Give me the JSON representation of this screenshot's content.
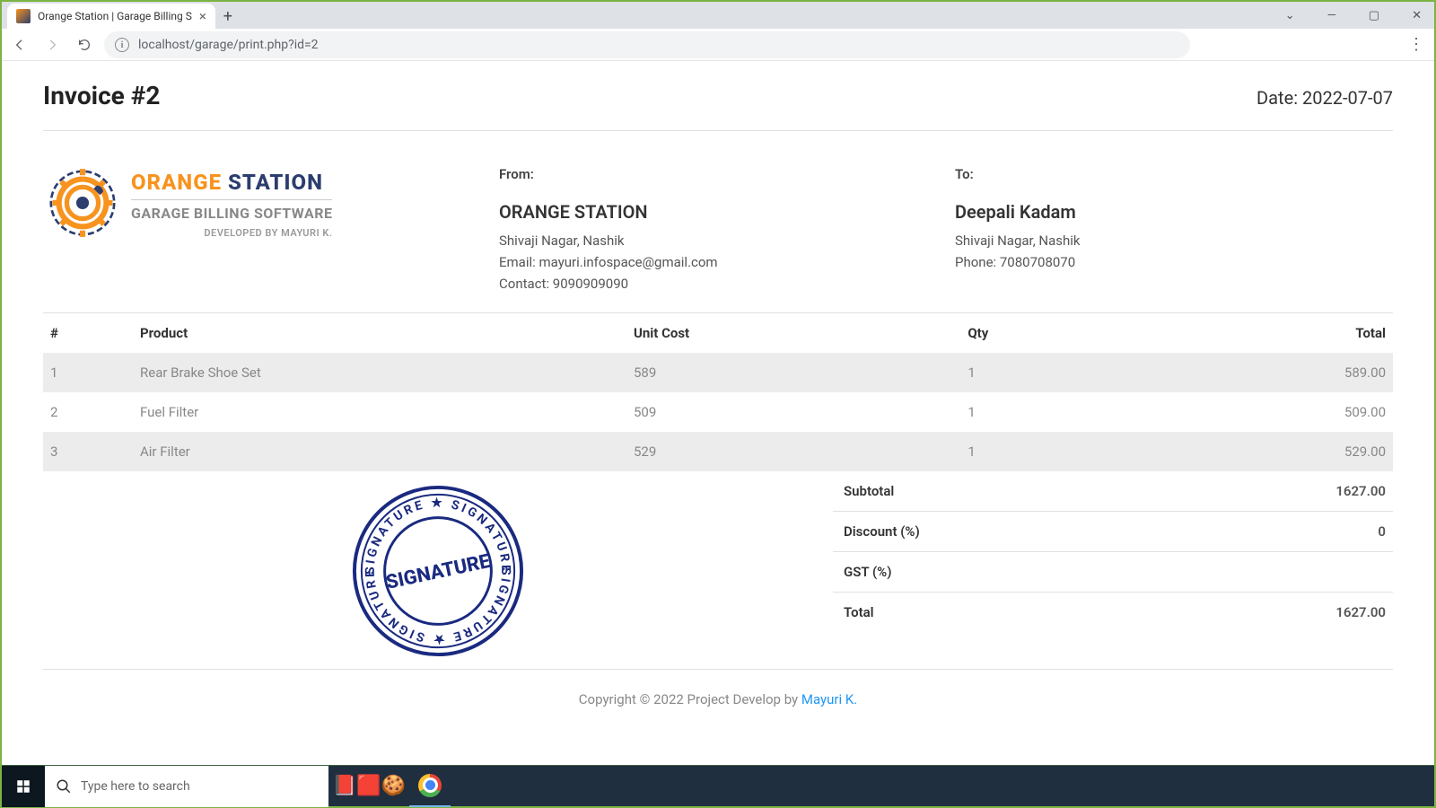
{
  "browser": {
    "tab_title": "Orange Station | Garage Billing S",
    "url": "localhost/garage/print.php?id=2"
  },
  "invoice": {
    "title": "Invoice #2",
    "date_label": "Date:",
    "date_value": "2022-07-07"
  },
  "logo": {
    "line1_a": "ORANGE",
    "line1_b": "STATION",
    "line2": "GARAGE BILLING SOFTWARE",
    "line3": "DEVELOPED BY MAYURI K."
  },
  "from": {
    "label": "From:",
    "name": "ORANGE STATION",
    "address": "Shivaji Nagar, Nashik",
    "email": "Email: mayuri.infospace@gmail.com",
    "contact": "Contact: 9090909090"
  },
  "to": {
    "label": "To:",
    "name": "Deepali Kadam",
    "address": "Shivaji Nagar, Nashik",
    "phone": "Phone: 7080708070"
  },
  "table": {
    "headers": {
      "num": "#",
      "product": "Product",
      "unit_cost": "Unit Cost",
      "qty": "Qty",
      "total": "Total"
    },
    "rows": [
      {
        "num": "1",
        "product": "Rear Brake Shoe Set",
        "unit_cost": "589",
        "qty": "1",
        "total": "589.00"
      },
      {
        "num": "2",
        "product": "Fuel Filter",
        "unit_cost": "509",
        "qty": "1",
        "total": "509.00"
      },
      {
        "num": "3",
        "product": "Air Filter",
        "unit_cost": "529",
        "qty": "1",
        "total": "529.00"
      }
    ]
  },
  "totals": {
    "subtotal_label": "Subtotal",
    "subtotal_value": "1627.00",
    "discount_label": "Discount (%)",
    "discount_value": "0",
    "gst_label": "GST (%)",
    "gst_value": "",
    "total_label": "Total",
    "total_value": "1627.00"
  },
  "footer": {
    "copyright": "Copyright © 2022 Project Develop by ",
    "author": "Mayuri K."
  },
  "taskbar": {
    "search_placeholder": "Type here to search"
  }
}
